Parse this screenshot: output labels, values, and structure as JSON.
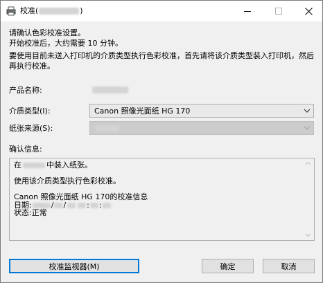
{
  "window": {
    "title_prefix": "校准(",
    "title_suffix": ")"
  },
  "intro": {
    "line1": "请确认色彩校准设置。",
    "line2": "开始校准后，大约需要 10 分钟。",
    "line3": "要使用目前未送入打印机的介质类型执行色彩校准，首先请将该介质类型装入打印机，然后再执行校准。"
  },
  "fields": {
    "product_name_label": "产品名称:",
    "media_type_label": "介质类型(I):",
    "media_type_value": "Canon 照像光面纸 HG 170",
    "paper_source_label": "纸张来源(S):"
  },
  "confirm": {
    "label": "确认信息:",
    "line1_prefix": "在",
    "line1_suffix": "中装入纸张。",
    "line2": "使用该介质类型执行色彩校准。",
    "line3": "Canon 照像光面纸 HG 170的校准信息",
    "date_label": " 日期:",
    "date_sep1": "/",
    "date_sep2": "/",
    "time_sep1": ":",
    "time_sep2": ":",
    "status": " 状态:正常"
  },
  "buttons": {
    "monitor": "校准监视器(M)",
    "ok": "确定",
    "cancel": "取消"
  },
  "icons": {
    "app": "printer-icon",
    "minimize": "minimize-icon",
    "maximize": "maximize-icon",
    "close": "close-icon",
    "dropdown": "chevron-down-icon",
    "scroll_up": "scroll-up-icon",
    "scroll_down": "scroll-down-icon"
  },
  "colors": {
    "accent": "#0078d7",
    "window_bg": "#f0f0f0",
    "titlebar_bg": "#ffffff"
  }
}
